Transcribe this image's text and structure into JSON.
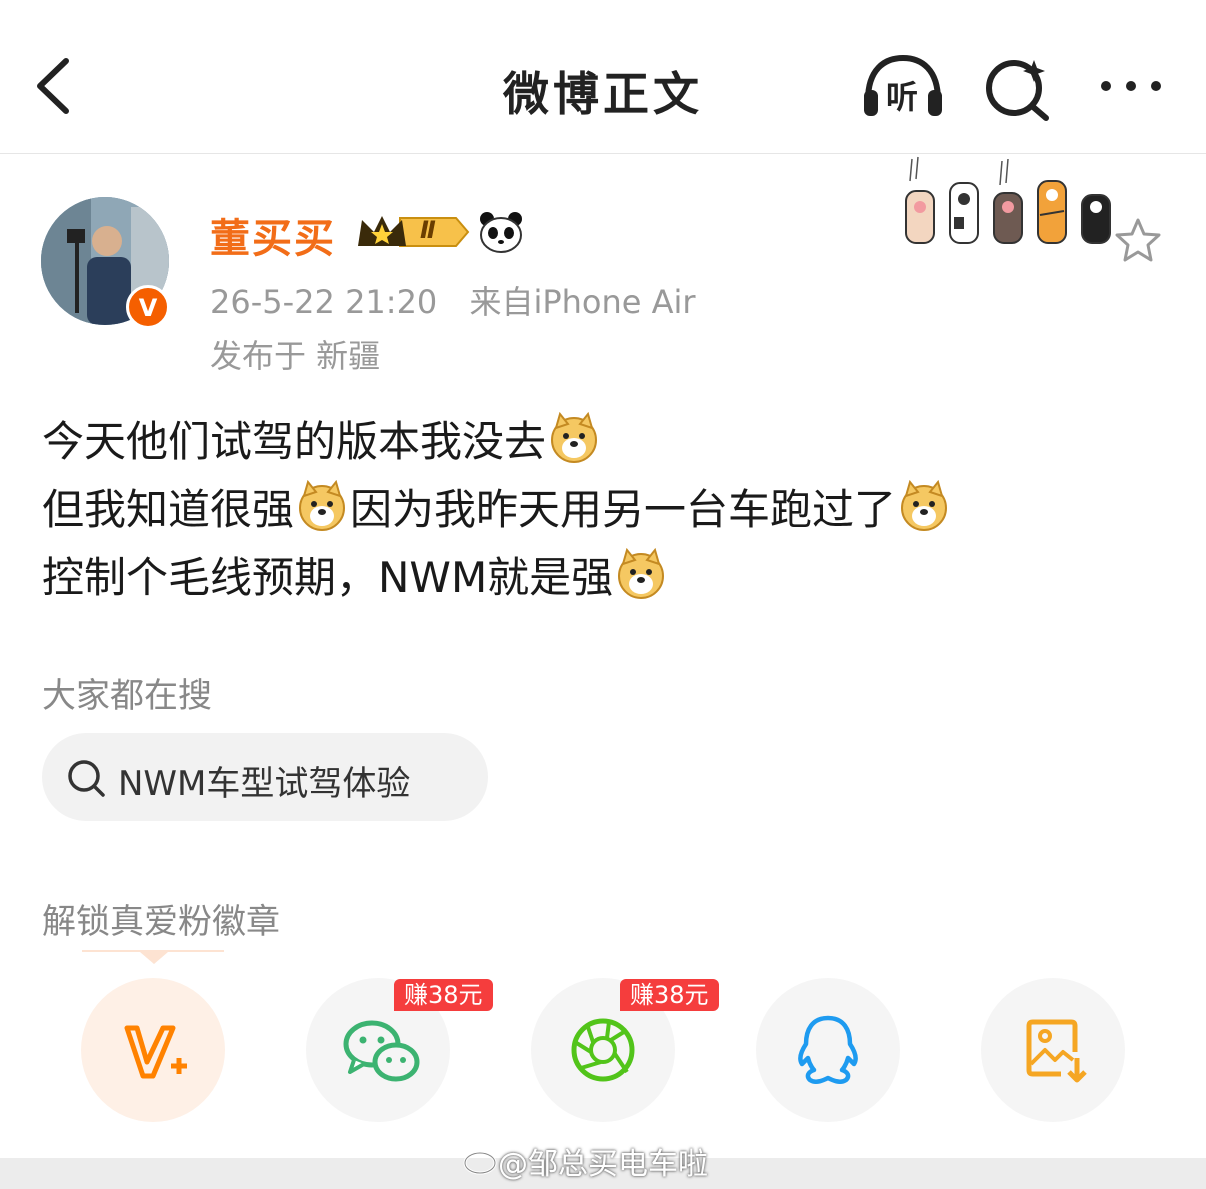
{
  "header": {
    "title": "微博正文",
    "listen_label": "听",
    "icons": [
      "back-icon",
      "listen-icon",
      "search-icon",
      "more-icon"
    ]
  },
  "post": {
    "username": "董买买",
    "vip_level": "Ⅱ",
    "verified_badge": "V",
    "timestamp": "26-5-22 21:20",
    "source": "来自iPhone Air",
    "location": "发布于 新疆",
    "lines": [
      [
        "今天他们试驾的版本我没去"
      ],
      [
        "但我知道很强",
        "因为我昨天用另一台车跑过了"
      ],
      [
        "控制个毛线预期，NWM就是强"
      ]
    ]
  },
  "trending": {
    "title": "大家都在搜",
    "chip_label": "NWM车型试驾体验"
  },
  "fans": {
    "title": "解锁真爱粉徽章",
    "share_items": [
      {
        "icon": "vip-plus-icon",
        "color": "#ff8200"
      },
      {
        "icon": "wechat-icon",
        "color": "#3cb371",
        "reward": "赚38元"
      },
      {
        "icon": "moments-icon",
        "color": "#52c41a",
        "reward": "赚38元"
      },
      {
        "icon": "qq-icon",
        "color": "#1e9bf0"
      },
      {
        "icon": "save-image-icon",
        "color": "#f5a623"
      }
    ]
  },
  "watermark": "@邹总买电车啦",
  "colors": {
    "accent": "#f26d18",
    "reward": "#f53d3d",
    "muted": "#999999"
  }
}
